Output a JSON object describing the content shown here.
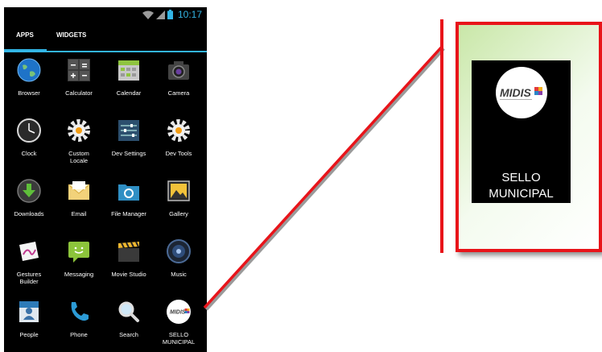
{
  "status_bar": {
    "time": "10:17",
    "icons": [
      "wifi-icon",
      "signal-icon",
      "battery-icon"
    ]
  },
  "tabs": [
    {
      "label": "APPS",
      "active": true
    },
    {
      "label": "WIDGETS",
      "active": false
    }
  ],
  "apps": [
    {
      "label": "Browser",
      "icon": "browser-icon"
    },
    {
      "label": "Calculator",
      "icon": "calculator-icon"
    },
    {
      "label": "Calendar",
      "icon": "calendar-icon"
    },
    {
      "label": "Camera",
      "icon": "camera-icon"
    },
    {
      "label": "Clock",
      "icon": "clock-icon"
    },
    {
      "label": "Custom\nLocale",
      "icon": "gear-icon"
    },
    {
      "label": "Dev Settings",
      "icon": "dev-settings-icon"
    },
    {
      "label": "Dev Tools",
      "icon": "gear-icon"
    },
    {
      "label": "Downloads",
      "icon": "download-icon"
    },
    {
      "label": "Email",
      "icon": "email-icon"
    },
    {
      "label": "File Manager",
      "icon": "folder-icon"
    },
    {
      "label": "Gallery",
      "icon": "gallery-icon"
    },
    {
      "label": "Gestures\nBuilder",
      "icon": "gestures-icon"
    },
    {
      "label": "Messaging",
      "icon": "messaging-icon"
    },
    {
      "label": "Movie Studio",
      "icon": "clapperboard-icon"
    },
    {
      "label": "Music",
      "icon": "music-icon"
    },
    {
      "label": "People",
      "icon": "people-icon"
    },
    {
      "label": "Phone",
      "icon": "phone-icon"
    },
    {
      "label": "Search",
      "icon": "search-icon"
    },
    {
      "label": "SELLO\nMUNICIPAL",
      "icon": "midis-logo-icon"
    }
  ],
  "callout": {
    "label": "SELLO\nMUNICIPAL",
    "logo_text": "MIDIS"
  },
  "colors": {
    "accent": "#33b5e5",
    "callout_border": "#e8141a",
    "phone_bg": "#000000"
  }
}
